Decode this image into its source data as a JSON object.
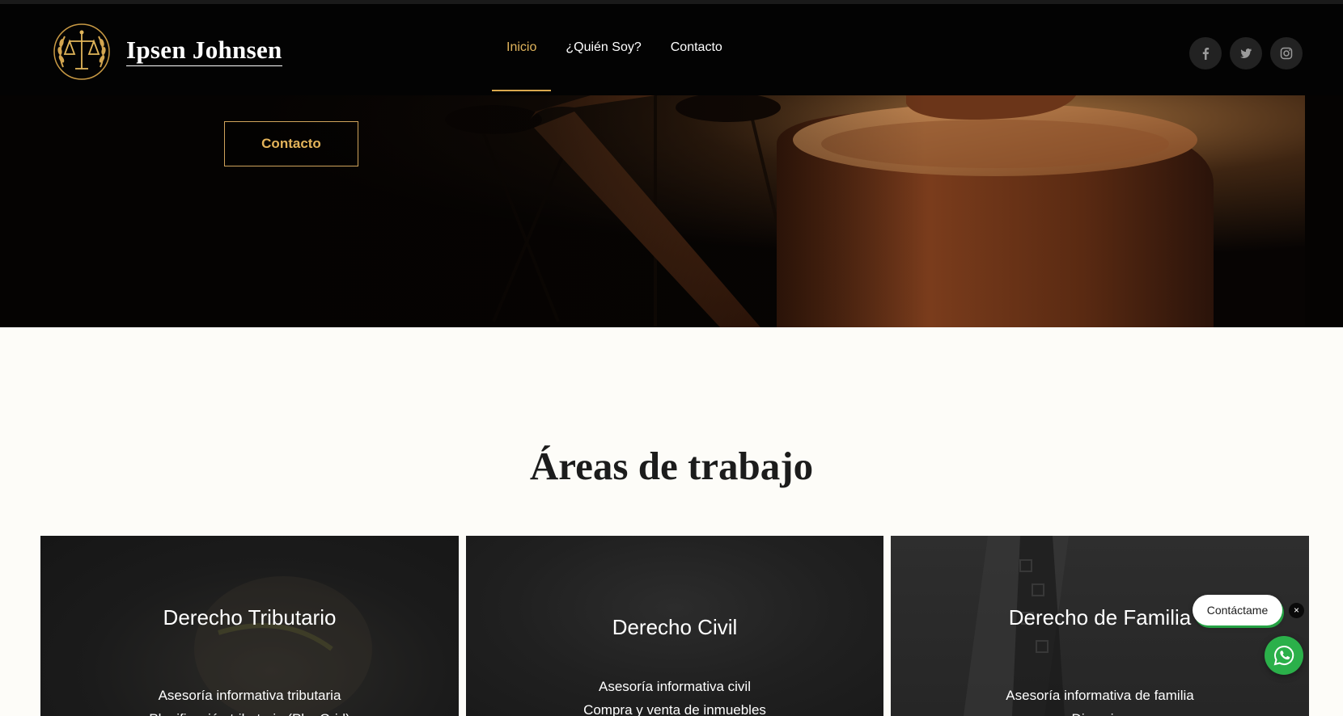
{
  "site": {
    "brand_name": "Ipsen Johnsen",
    "logo_icon": "scales-of-justice-laurel-icon",
    "colors": {
      "accent_gold": "#d9a94e",
      "header_bg": "#030303",
      "page_bg": "#fdfcf8",
      "whatsapp_green": "#2bb04a"
    }
  },
  "nav": {
    "items": [
      {
        "label": "Inicio",
        "active": true
      },
      {
        "label": "¿Quién Soy?",
        "active": false
      },
      {
        "label": "Contacto",
        "active": false
      }
    ]
  },
  "socials": [
    {
      "icon": "facebook-icon"
    },
    {
      "icon": "twitter-icon"
    },
    {
      "icon": "instagram-icon"
    }
  ],
  "hero": {
    "button_label": "Contacto",
    "image": "judge-gavel-photo"
  },
  "areas": {
    "title": "Áreas de trabajo",
    "cards": [
      {
        "title": "Derecho Tributario",
        "items": [
          "Asesoría informativa tributaria",
          "Planificación tributaria (PlanGrid)"
        ]
      },
      {
        "title": "Derecho Civil",
        "items": [
          "Asesoría informativa civil",
          "Compra y venta de inmuebles"
        ]
      },
      {
        "title": "Derecho de Familia",
        "items": [
          "Asesoría informativa de familia",
          "Divorcios"
        ]
      }
    ]
  },
  "whatsapp": {
    "bubble_label": "Contáctame",
    "close_label": "×",
    "icon": "whatsapp-icon"
  }
}
